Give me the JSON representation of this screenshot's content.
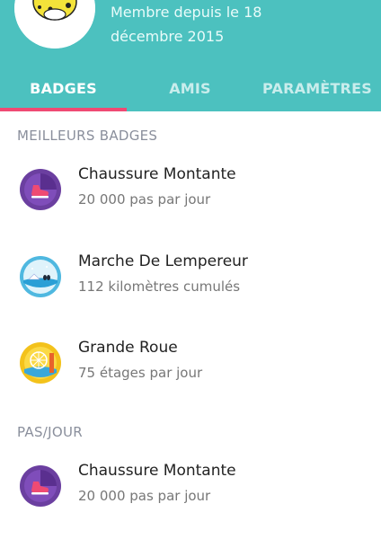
{
  "profile": {
    "member_line1": "Membre depuis le 18",
    "member_line2": "décembre 2015"
  },
  "tabs": [
    {
      "label": "BADGES",
      "active": true
    },
    {
      "label": "AMIS",
      "active": false
    },
    {
      "label": "PARAMÈTRES",
      "active": false
    }
  ],
  "sections": [
    {
      "title": "MEILLEURS BADGES",
      "items": [
        {
          "title": "Chaussure Montante",
          "subtitle": "20 000 pas par jour",
          "icon": "shoe-badge-icon"
        },
        {
          "title": "Marche De Lempereur",
          "subtitle": "112 kilomètres cumulés",
          "icon": "penguin-badge-icon"
        },
        {
          "title": "Grande Roue",
          "subtitle": "75 étages par jour",
          "icon": "ferris-wheel-badge-icon"
        }
      ]
    },
    {
      "title": "PAS/JOUR",
      "items": [
        {
          "title": "Chaussure Montante",
          "subtitle": "20 000 pas par jour",
          "icon": "shoe-badge-icon"
        }
      ]
    }
  ],
  "colors": {
    "header": "#4cc1bf",
    "tab_indicator": "#ef4a73",
    "section_title": "#8a8f9c"
  }
}
